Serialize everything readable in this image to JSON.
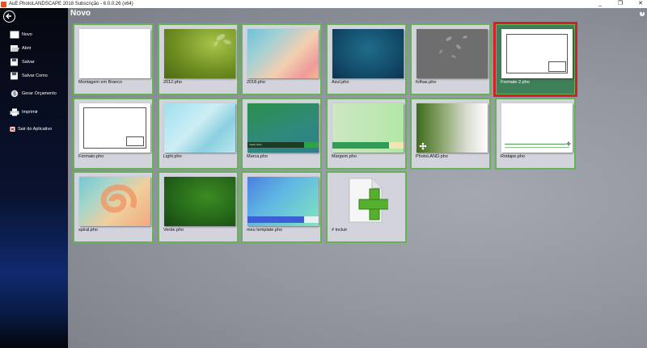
{
  "window": {
    "title": "AuE PhotoLANDSCAPE 2018 Subscrição - 6.0.0.26 (x64)",
    "controls": [
      "_",
      "❐",
      "✕"
    ]
  },
  "sidebar": {
    "items": [
      {
        "label": "Novo",
        "icon": "new-document-icon"
      },
      {
        "label": "Abrir",
        "icon": "open-folder-icon"
      },
      {
        "label": "Salvar",
        "icon": "save-icon"
      },
      {
        "label": "Salvar Como",
        "icon": "save-as-icon"
      },
      {
        "label": "Gerar Orçamento",
        "icon": "budget-icon"
      },
      {
        "label": "Imprimir",
        "icon": "printer-icon"
      },
      {
        "label": "Sair do Aplicativo",
        "icon": "exit-icon"
      }
    ]
  },
  "main": {
    "title": "Novo",
    "help": "?",
    "templates": [
      {
        "label": "Montagem em Branco"
      },
      {
        "label": "2012.pho"
      },
      {
        "label": "2018.pho"
      },
      {
        "label": "Azul.pho"
      },
      {
        "label": "folhas.pho"
      },
      {
        "label": "Formato 2.pho",
        "selected": true
      },
      {
        "label": "Formato.pho"
      },
      {
        "label": "Light.pho"
      },
      {
        "label": "Marca.pho",
        "thumb_text": "Inserir texto"
      },
      {
        "label": "Margem.pho"
      },
      {
        "label": "PhotoLAND.pho"
      },
      {
        "label": "Rodape.pho"
      },
      {
        "label": "spiral.pho"
      },
      {
        "label": "Verde.pho"
      },
      {
        "label": "meu template.pho"
      },
      {
        "label": "# Incluir"
      }
    ]
  },
  "colors": {
    "tile_border": "#67b257",
    "selected_tile": "#3f7f59",
    "selection_frame": "#d32027"
  }
}
